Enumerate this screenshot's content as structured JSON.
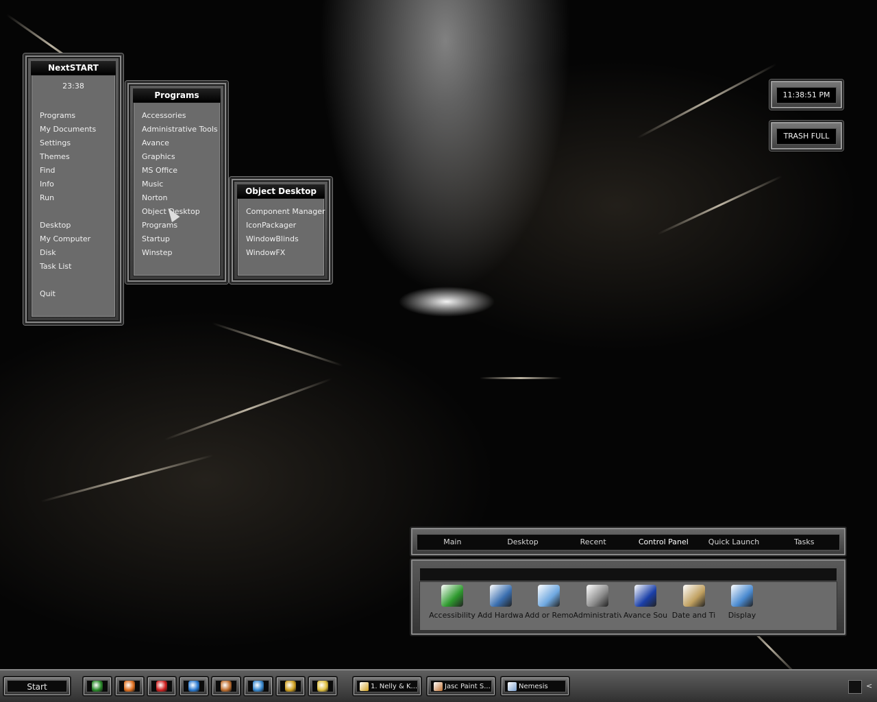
{
  "nextstart": {
    "title": "NextSTART",
    "clock": "23:38",
    "items": [
      "Programs",
      "My Documents",
      "Settings",
      "Themes",
      "Find",
      "Info",
      "Run",
      "",
      "Desktop",
      "My Computer",
      "Disk",
      "Task List",
      "",
      "Quit"
    ]
  },
  "programs": {
    "title": "Programs",
    "items": [
      "Accessories",
      "Administrative Tools",
      "Avance",
      "Graphics",
      "MS Office",
      "Music",
      "Norton",
      "Object Desktop",
      "Programs",
      "Startup",
      "Winstep"
    ]
  },
  "object_desktop": {
    "title": "Object Desktop",
    "items": [
      "Component Manager",
      "IconPackager",
      "WindowBlinds",
      "WindowFX"
    ]
  },
  "widgets": {
    "clock": "11:38:51 PM",
    "trash": "TRASH FULL"
  },
  "control_bar": {
    "tabs": [
      "Main",
      "Desktop",
      "Recent",
      "Control Panel",
      "Quick Launch",
      "Tasks"
    ],
    "active_tab": "Control Panel",
    "items": [
      {
        "label": "Accessibility",
        "icon": "accessibility-icon",
        "color": "#2e9a2e"
      },
      {
        "label": "Add Hardwa",
        "icon": "add-hardware-icon",
        "color": "#3a6fb0"
      },
      {
        "label": "Add or Remo",
        "icon": "add-remove-programs-icon",
        "color": "#6fa8e0"
      },
      {
        "label": "Administrativ",
        "icon": "administrative-tools-icon",
        "color": "#8a8a8a"
      },
      {
        "label": "Avance Sou",
        "icon": "avance-sound-icon",
        "color": "#1a3fa8"
      },
      {
        "label": "Date and Ti",
        "icon": "date-time-icon",
        "color": "#c0a060"
      },
      {
        "label": "Display",
        "icon": "display-icon",
        "color": "#4a8ad0"
      }
    ]
  },
  "taskbar": {
    "start_label": "Start",
    "quick_launch": [
      {
        "icon": "winamp-icon",
        "color": "#2a8a2a"
      },
      {
        "icon": "mail-icon",
        "color": "#e07020"
      },
      {
        "icon": "red-app-icon",
        "color": "#d02020"
      },
      {
        "icon": "internet-explorer-icon",
        "color": "#2a7ad0"
      },
      {
        "icon": "paint-shop-icon",
        "color": "#c07030"
      },
      {
        "icon": "browser-icon",
        "color": "#3a8ad0"
      },
      {
        "icon": "winamp-bolt-icon",
        "color": "#d0a020"
      },
      {
        "icon": "media-player-icon",
        "color": "#e0c040"
      }
    ],
    "tasks": [
      {
        "label": "1. Nelly & K...",
        "icon": "winamp-bolt-icon",
        "color": "#d0a020"
      },
      {
        "label": "Jasc Paint S...",
        "icon": "paint-shop-icon",
        "color": "#c07030"
      },
      {
        "label": "Nemesis",
        "icon": "window-icon",
        "color": "#7aa0d0"
      }
    ],
    "tray_chevron": "<"
  }
}
